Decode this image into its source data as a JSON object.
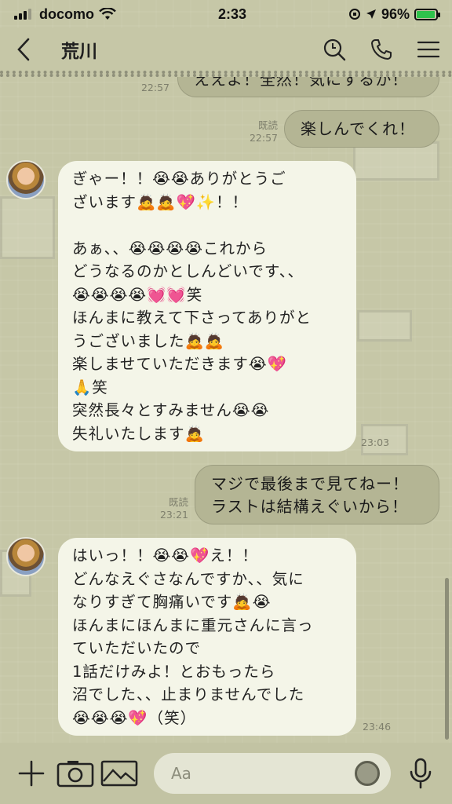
{
  "status_bar": {
    "carrier": "docomo",
    "time": "2:33",
    "battery_pct": "96%",
    "battery_level": 0.96
  },
  "header": {
    "title": "荒川",
    "icons": [
      "back-chevron-icon",
      "search-icon",
      "phone-icon",
      "menu-icon"
    ]
  },
  "messages": [
    {
      "side": "out",
      "text": "ええよ！全然！気にするか！",
      "time": "22:57",
      "read": ""
    },
    {
      "side": "out",
      "text": "楽しんでくれ！",
      "time": "22:57",
      "read": "既読"
    },
    {
      "side": "in",
      "text": "ぎゃー！！😭😭ありがとうご\nざいます🙇🙇💖✨！！\n\nあぁ、、😭😭😭😭これから\nどうなるのかとしんどいです、、\n😭😭😭😭💓💓笑\nほんまに教えて下さってありがと\nうございました🙇🙇\n楽しませていただきます😭💖\n🙏笑\n突然長々とすみません😭😭\n失礼いたします🙇",
      "time": "23:03"
    },
    {
      "side": "out",
      "text": "マジで最後まで見てねー！\nラストは結構えぐいから！",
      "time": "23:21",
      "read": "既読"
    },
    {
      "side": "in",
      "text": "はいっ！！😭😭💖え！！\nどんなえぐさなんですか、、気に\nなりすぎて胸痛いです🙇😭\nほんまにほんまに重元さんに言っ\nていただいたので\n1話だけみよ！とおもったら\n沼でした、、止まりませんでした\n😭😭😭💖（笑）",
      "time": "23:46"
    }
  ],
  "input": {
    "placeholder": "Aa"
  },
  "bottom_icons": [
    "plus-icon",
    "camera-icon",
    "image-icon",
    "emoji-icon",
    "microphone-icon"
  ],
  "colors": {
    "background": "#c6c7a7",
    "incoming_bubble": "#f4f5e8",
    "outgoing_bubble": "#b4b594"
  }
}
